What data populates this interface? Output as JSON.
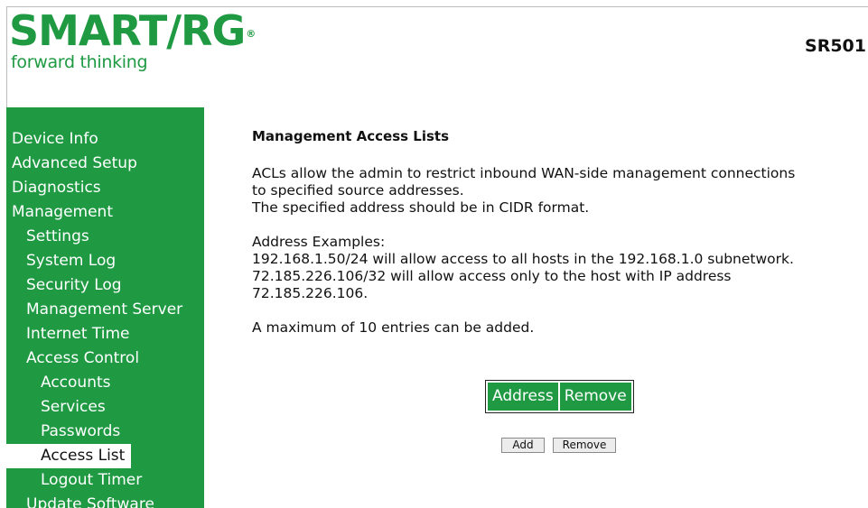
{
  "header": {
    "brand": "SMART/RG",
    "registered_mark": "®",
    "tagline": "forward thinking",
    "model": "SR501"
  },
  "colors": {
    "brand_green": "#1f9a43",
    "sidebar_bg": "#1f9a43",
    "active_item_bg": "#ffffff"
  },
  "sidebar": {
    "items": [
      {
        "label": "Device Info",
        "level": 1
      },
      {
        "label": "Advanced Setup",
        "level": 1
      },
      {
        "label": "Diagnostics",
        "level": 1
      },
      {
        "label": "Management",
        "level": 1
      },
      {
        "label": "Settings",
        "level": 2
      },
      {
        "label": "System Log",
        "level": 2
      },
      {
        "label": "Security Log",
        "level": 2
      },
      {
        "label": "Management Server",
        "level": 2
      },
      {
        "label": "Internet Time",
        "level": 2
      },
      {
        "label": "Access Control",
        "level": 2
      },
      {
        "label": "Accounts",
        "level": 3
      },
      {
        "label": "Services",
        "level": 3
      },
      {
        "label": "Passwords",
        "level": 3
      },
      {
        "label": "Access List",
        "level": 3,
        "active": true
      },
      {
        "label": "Logout Timer",
        "level": 3
      },
      {
        "label": "Update Software",
        "level": 2
      }
    ]
  },
  "main": {
    "title": "Management Access Lists",
    "description_line1": "ACLs allow the admin to restrict inbound WAN-side management connections",
    "description_line2": "to specified source addresses.",
    "description_line3": "The specified address should be in CIDR format.",
    "examples_heading": "Address Examples:",
    "example1": "192.168.1.50/24 will allow access to all hosts in the 192.168.1.0 subnetwork.",
    "example2_line1": "72.185.226.106/32 will allow access only to the host with IP address",
    "example2_line2": "72.185.226.106.",
    "max_entries": "A maximum of 10 entries can be added.",
    "table": {
      "columns": [
        "Address",
        "Remove"
      ]
    },
    "buttons": {
      "add": "Add",
      "remove": "Remove"
    }
  }
}
